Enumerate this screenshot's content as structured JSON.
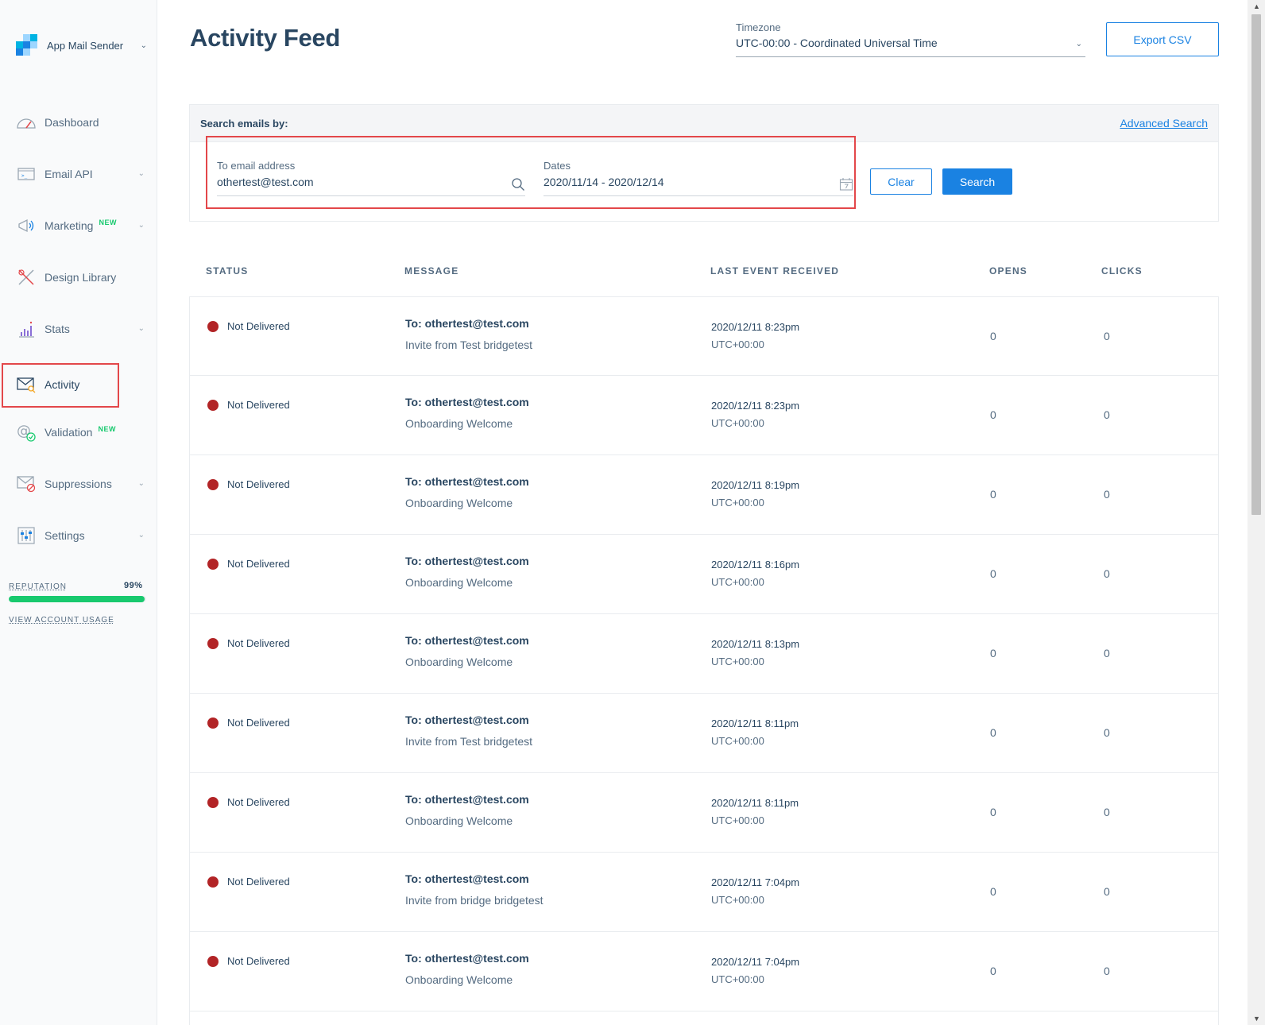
{
  "account": {
    "name": "App Mail Sender"
  },
  "sidebar": {
    "items": [
      {
        "label": "Dashboard",
        "icon": "dashboard-icon",
        "new": "",
        "chevron": false
      },
      {
        "label": "Email API",
        "icon": "email-api-icon",
        "new": "",
        "chevron": true
      },
      {
        "label": "Marketing",
        "icon": "marketing-megaphone-icon",
        "new": "NEW",
        "chevron": true
      },
      {
        "label": "Design Library",
        "icon": "design-library-icon",
        "new": "",
        "chevron": false
      },
      {
        "label": "Stats",
        "icon": "stats-icon",
        "new": "",
        "chevron": true
      },
      {
        "label": "Activity",
        "icon": "activity-envelope-icon",
        "new": "",
        "chevron": false
      },
      {
        "label": "Validation",
        "icon": "validation-at-icon",
        "new": "NEW",
        "chevron": false
      },
      {
        "label": "Suppressions",
        "icon": "suppressions-icon",
        "new": "",
        "chevron": true
      },
      {
        "label": "Settings",
        "icon": "settings-sliders-icon",
        "new": "",
        "chevron": true
      }
    ],
    "reputation_label": "REPUTATION",
    "reputation_value": "99%",
    "reputation_fraction": 0.99,
    "usage_link": "VIEW ACCOUNT USAGE"
  },
  "header": {
    "title": "Activity Feed",
    "timezone_label": "Timezone",
    "timezone_value": "UTC-00:00 - Coordinated Universal Time",
    "export_label": "Export CSV"
  },
  "search": {
    "heading": "Search emails by:",
    "advanced_link": "Advanced Search",
    "email_label": "To email address",
    "email_value": "othertest@test.com",
    "dates_label": "Dates",
    "dates_value": "2020/11/14 - 2020/12/14",
    "clear_label": "Clear",
    "search_label": "Search"
  },
  "table": {
    "columns": [
      "STATUS",
      "MESSAGE",
      "LAST EVENT RECEIVED",
      "OPENS",
      "CLICKS"
    ],
    "rows": [
      {
        "status": "Not Delivered",
        "to": "To: othertest@test.com",
        "subject": "Invite from Test bridgetest",
        "date": "2020/12/11 8:23pm",
        "tz": "UTC+00:00",
        "opens": "0",
        "clicks": "0"
      },
      {
        "status": "Not Delivered",
        "to": "To: othertest@test.com",
        "subject": "Onboarding Welcome",
        "date": "2020/12/11 8:23pm",
        "tz": "UTC+00:00",
        "opens": "0",
        "clicks": "0"
      },
      {
        "status": "Not Delivered",
        "to": "To: othertest@test.com",
        "subject": "Onboarding Welcome",
        "date": "2020/12/11 8:19pm",
        "tz": "UTC+00:00",
        "opens": "0",
        "clicks": "0"
      },
      {
        "status": "Not Delivered",
        "to": "To: othertest@test.com",
        "subject": "Onboarding Welcome",
        "date": "2020/12/11 8:16pm",
        "tz": "UTC+00:00",
        "opens": "0",
        "clicks": "0"
      },
      {
        "status": "Not Delivered",
        "to": "To: othertest@test.com",
        "subject": "Onboarding Welcome",
        "date": "2020/12/11 8:13pm",
        "tz": "UTC+00:00",
        "opens": "0",
        "clicks": "0"
      },
      {
        "status": "Not Delivered",
        "to": "To: othertest@test.com",
        "subject": "Invite from Test bridgetest",
        "date": "2020/12/11 8:11pm",
        "tz": "UTC+00:00",
        "opens": "0",
        "clicks": "0"
      },
      {
        "status": "Not Delivered",
        "to": "To: othertest@test.com",
        "subject": "Onboarding Welcome",
        "date": "2020/12/11 8:11pm",
        "tz": "UTC+00:00",
        "opens": "0",
        "clicks": "0"
      },
      {
        "status": "Not Delivered",
        "to": "To: othertest@test.com",
        "subject": "Invite from bridge bridgetest",
        "date": "2020/12/11 7:04pm",
        "tz": "UTC+00:00",
        "opens": "0",
        "clicks": "0"
      },
      {
        "status": "Not Delivered",
        "to": "To: othertest@test.com",
        "subject": "Onboarding Welcome",
        "date": "2020/12/11 7:04pm",
        "tz": "UTC+00:00",
        "opens": "0",
        "clicks": "0"
      }
    ]
  },
  "colors": {
    "accent": "#1a82e2",
    "not_delivered": "#b22426",
    "highlight": "#e3474a",
    "reputation": "#18c96e"
  }
}
